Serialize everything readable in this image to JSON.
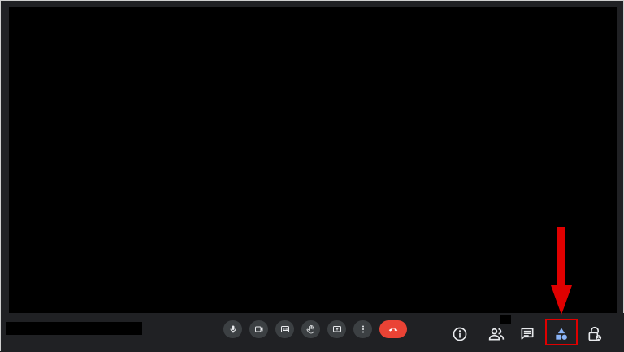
{
  "colors": {
    "background": "#202124",
    "stage": "#000000",
    "control_button": "#3c4043",
    "end_call": "#ea4335",
    "icon": "#e8eaed",
    "activities_icon": "#8ab4f8",
    "annotation_red": "#e00000"
  },
  "controls": {
    "center": [
      {
        "name": "microphone-button",
        "icon": "microphone-icon"
      },
      {
        "name": "camera-button",
        "icon": "video-camera-icon"
      },
      {
        "name": "captions-button",
        "icon": "closed-captions-icon"
      },
      {
        "name": "raise-hand-button",
        "icon": "hand-icon"
      },
      {
        "name": "present-button",
        "icon": "present-screen-icon"
      },
      {
        "name": "more-options-button",
        "icon": "vertical-dots-icon"
      }
    ],
    "end_call": {
      "name": "end-call-button",
      "icon": "hang-up-phone-icon"
    },
    "right": [
      {
        "name": "meeting-details-button",
        "icon": "info-icon"
      },
      {
        "name": "people-button",
        "icon": "people-icon"
      },
      {
        "name": "chat-button",
        "icon": "chat-icon"
      },
      {
        "name": "activities-button",
        "icon": "activities-shapes-icon"
      },
      {
        "name": "host-controls-button",
        "icon": "lock-person-icon"
      }
    ]
  },
  "annotation": {
    "type": "arrow-and-box",
    "target": "activities-button"
  }
}
